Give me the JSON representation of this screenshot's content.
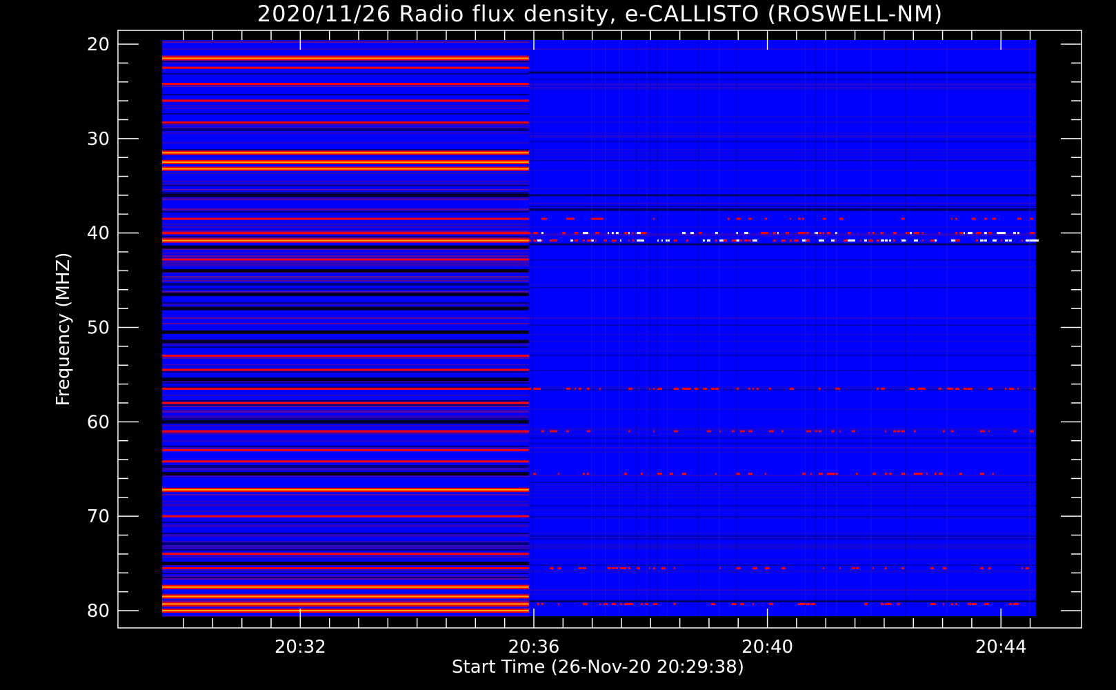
{
  "chart_data": {
    "type": "heatmap",
    "title": "2020/11/26  Radio flux density, e-CALLISTO (ROSWELL-NM)",
    "xlabel": "Start Time (26-Nov-20 20:29:38)",
    "ylabel": "Frequency (MHZ)",
    "x_range": [
      "20:29:38",
      "20:44:36"
    ],
    "ylim": [
      80,
      20
    ],
    "y_inverted": true,
    "x_ticks": [
      "20:32",
      "20:36",
      "20:40",
      "20:44"
    ],
    "y_ticks": [
      "20",
      "30",
      "40",
      "50",
      "60",
      "70",
      "80"
    ],
    "transition_time": "20:35:55",
    "colormap": [
      "#000000",
      "#0000ff",
      "#ff0000",
      "#ffa500",
      "#ffff00",
      "#ffffff"
    ],
    "series": [
      {
        "time_window": [
          "20:29:38",
          "20:35:55"
        ],
        "bright_bands_mhz": [
          21.5,
          22.5,
          24.2,
          26.0,
          28.3,
          31.5,
          32.5,
          33.2,
          38.5,
          40.0,
          40.8,
          42.8,
          53.0,
          54.5,
          56.5,
          58.0,
          61.0,
          63.0,
          64.2,
          67.2,
          70.0,
          74.0,
          75.5,
          77.5,
          78.5,
          79.3,
          80.0
        ],
        "dark_bands_mhz": [
          36.0,
          41.5,
          44.0,
          46.5,
          48.0,
          50.5,
          51.5,
          55.5,
          60.0,
          65.5,
          75.0
        ]
      },
      {
        "time_window": [
          "20:35:55",
          "20:44:36"
        ],
        "bright_bands_mhz": [
          40.0,
          40.8,
          38.5,
          56.5,
          61.0,
          65.5,
          75.5,
          79.3
        ],
        "dark_bands_mhz": [
          23.0,
          36.0,
          37.5,
          41.2,
          79.0
        ]
      }
    ]
  }
}
